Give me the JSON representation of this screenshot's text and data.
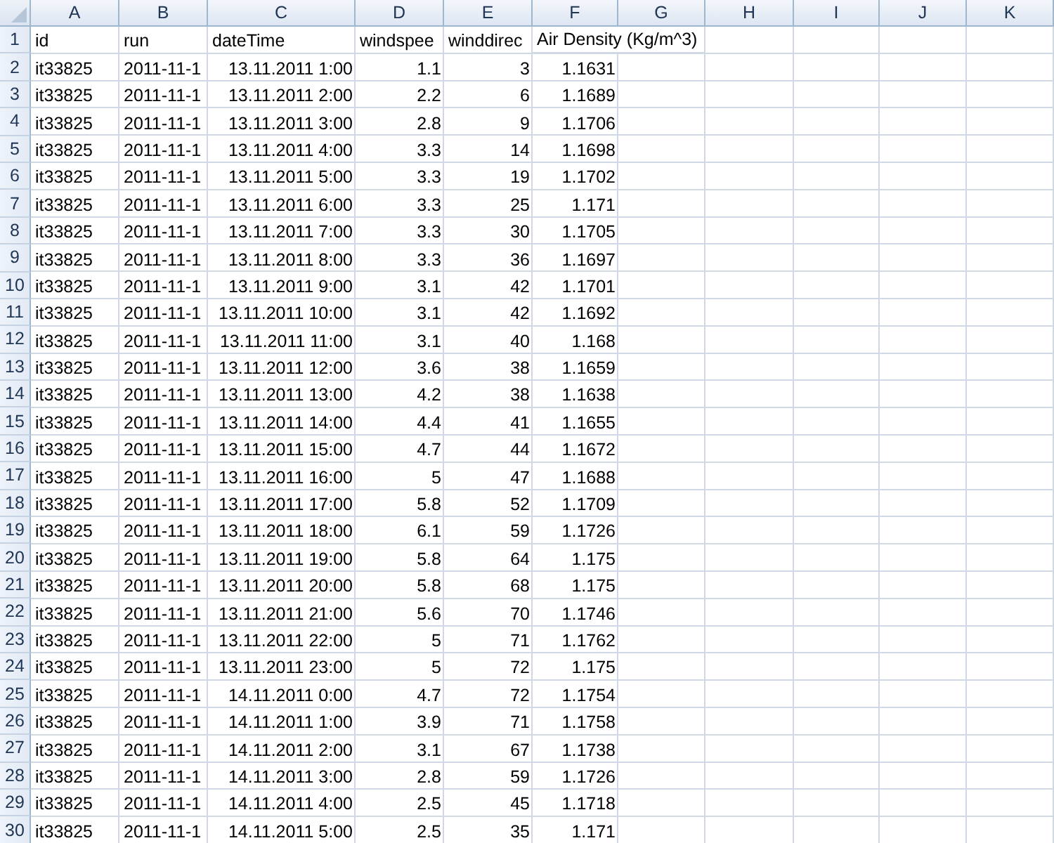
{
  "columns": [
    {
      "letter": "A",
      "kind": "text"
    },
    {
      "letter": "B",
      "kind": "text"
    },
    {
      "letter": "C",
      "kind": "number"
    },
    {
      "letter": "D",
      "kind": "number"
    },
    {
      "letter": "E",
      "kind": "number"
    },
    {
      "letter": "F",
      "kind": "number"
    },
    {
      "letter": "G",
      "kind": "text"
    },
    {
      "letter": "H",
      "kind": "text"
    },
    {
      "letter": "I",
      "kind": "text"
    },
    {
      "letter": "J",
      "kind": "text"
    },
    {
      "letter": "K",
      "kind": "text"
    }
  ],
  "rows": [
    {
      "number": "1",
      "kind": "label",
      "cells": [
        "id",
        "run",
        "dateTime",
        "windspee",
        "winddirec",
        "Air Density (Kg/m^3)"
      ]
    },
    {
      "number": "2",
      "kind": "data",
      "cells": [
        "it33825",
        "2011-11-1",
        "13.11.2011 1:00",
        "1.1",
        "3",
        "1.1631"
      ]
    },
    {
      "number": "3",
      "kind": "data",
      "cells": [
        "it33825",
        "2011-11-1",
        "13.11.2011 2:00",
        "2.2",
        "6",
        "1.1689"
      ]
    },
    {
      "number": "4",
      "kind": "data",
      "cells": [
        "it33825",
        "2011-11-1",
        "13.11.2011 3:00",
        "2.8",
        "9",
        "1.1706"
      ]
    },
    {
      "number": "5",
      "kind": "data",
      "cells": [
        "it33825",
        "2011-11-1",
        "13.11.2011 4:00",
        "3.3",
        "14",
        "1.1698"
      ]
    },
    {
      "number": "6",
      "kind": "data",
      "cells": [
        "it33825",
        "2011-11-1",
        "13.11.2011 5:00",
        "3.3",
        "19",
        "1.1702"
      ]
    },
    {
      "number": "7",
      "kind": "data",
      "cells": [
        "it33825",
        "2011-11-1",
        "13.11.2011 6:00",
        "3.3",
        "25",
        "1.171"
      ]
    },
    {
      "number": "8",
      "kind": "data",
      "cells": [
        "it33825",
        "2011-11-1",
        "13.11.2011 7:00",
        "3.3",
        "30",
        "1.1705"
      ]
    },
    {
      "number": "9",
      "kind": "data",
      "cells": [
        "it33825",
        "2011-11-1",
        "13.11.2011 8:00",
        "3.3",
        "36",
        "1.1697"
      ]
    },
    {
      "number": "10",
      "kind": "data",
      "cells": [
        "it33825",
        "2011-11-1",
        "13.11.2011 9:00",
        "3.1",
        "42",
        "1.1701"
      ]
    },
    {
      "number": "11",
      "kind": "data",
      "cells": [
        "it33825",
        "2011-11-1",
        "13.11.2011 10:00",
        "3.1",
        "42",
        "1.1692"
      ]
    },
    {
      "number": "12",
      "kind": "data",
      "cells": [
        "it33825",
        "2011-11-1",
        "13.11.2011 11:00",
        "3.1",
        "40",
        "1.168"
      ]
    },
    {
      "number": "13",
      "kind": "data",
      "cells": [
        "it33825",
        "2011-11-1",
        "13.11.2011 12:00",
        "3.6",
        "38",
        "1.1659"
      ]
    },
    {
      "number": "14",
      "kind": "data",
      "cells": [
        "it33825",
        "2011-11-1",
        "13.11.2011 13:00",
        "4.2",
        "38",
        "1.1638"
      ]
    },
    {
      "number": "15",
      "kind": "data",
      "cells": [
        "it33825",
        "2011-11-1",
        "13.11.2011 14:00",
        "4.4",
        "41",
        "1.1655"
      ]
    },
    {
      "number": "16",
      "kind": "data",
      "cells": [
        "it33825",
        "2011-11-1",
        "13.11.2011 15:00",
        "4.7",
        "44",
        "1.1672"
      ]
    },
    {
      "number": "17",
      "kind": "data",
      "cells": [
        "it33825",
        "2011-11-1",
        "13.11.2011 16:00",
        "5",
        "47",
        "1.1688"
      ]
    },
    {
      "number": "18",
      "kind": "data",
      "cells": [
        "it33825",
        "2011-11-1",
        "13.11.2011 17:00",
        "5.8",
        "52",
        "1.1709"
      ]
    },
    {
      "number": "19",
      "kind": "data",
      "cells": [
        "it33825",
        "2011-11-1",
        "13.11.2011 18:00",
        "6.1",
        "59",
        "1.1726"
      ]
    },
    {
      "number": "20",
      "kind": "data",
      "cells": [
        "it33825",
        "2011-11-1",
        "13.11.2011 19:00",
        "5.8",
        "64",
        "1.175"
      ]
    },
    {
      "number": "21",
      "kind": "data",
      "cells": [
        "it33825",
        "2011-11-1",
        "13.11.2011 20:00",
        "5.8",
        "68",
        "1.175"
      ]
    },
    {
      "number": "22",
      "kind": "data",
      "cells": [
        "it33825",
        "2011-11-1",
        "13.11.2011 21:00",
        "5.6",
        "70",
        "1.1746"
      ]
    },
    {
      "number": "23",
      "kind": "data",
      "cells": [
        "it33825",
        "2011-11-1",
        "13.11.2011 22:00",
        "5",
        "71",
        "1.1762"
      ]
    },
    {
      "number": "24",
      "kind": "data",
      "cells": [
        "it33825",
        "2011-11-1",
        "13.11.2011 23:00",
        "5",
        "72",
        "1.175"
      ]
    },
    {
      "number": "25",
      "kind": "data",
      "cells": [
        "it33825",
        "2011-11-1",
        "14.11.2011 0:00",
        "4.7",
        "72",
        "1.1754"
      ]
    },
    {
      "number": "26",
      "kind": "data",
      "cells": [
        "it33825",
        "2011-11-1",
        "14.11.2011 1:00",
        "3.9",
        "71",
        "1.1758"
      ]
    },
    {
      "number": "27",
      "kind": "data",
      "cells": [
        "it33825",
        "2011-11-1",
        "14.11.2011 2:00",
        "3.1",
        "67",
        "1.1738"
      ]
    },
    {
      "number": "28",
      "kind": "data",
      "cells": [
        "it33825",
        "2011-11-1",
        "14.11.2011 3:00",
        "2.8",
        "59",
        "1.1726"
      ]
    },
    {
      "number": "29",
      "kind": "data",
      "cells": [
        "it33825",
        "2011-11-1",
        "14.11.2011 4:00",
        "2.5",
        "45",
        "1.1718"
      ]
    },
    {
      "number": "30",
      "kind": "data",
      "cells": [
        "it33825",
        "2011-11-1",
        "14.11.2011 5:00",
        "2.5",
        "35",
        "1.171"
      ]
    }
  ]
}
